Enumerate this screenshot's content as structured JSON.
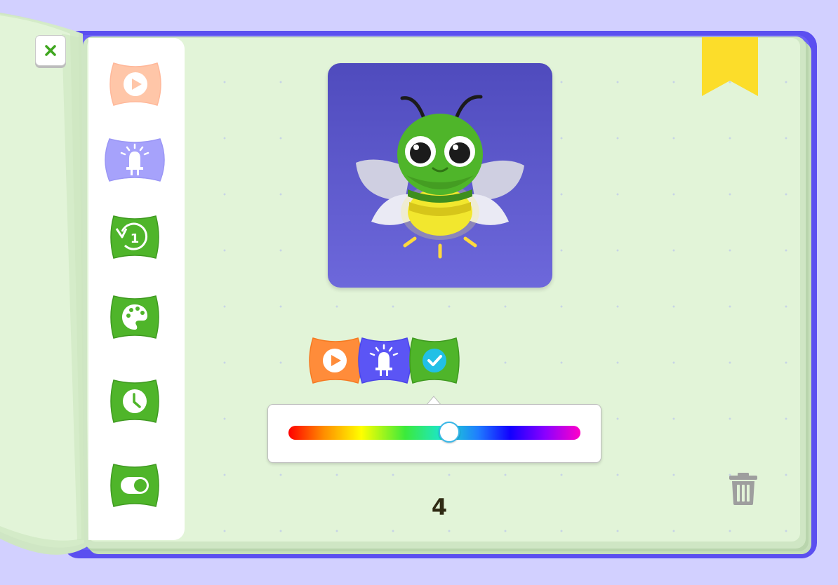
{
  "toolbar": {
    "close_icon": "close-icon",
    "bookmark_color": "#fcdd2a"
  },
  "palette": {
    "blocks": [
      {
        "icon": "play-icon",
        "category": "trigger",
        "color": "#ffc6a8",
        "state": "faded"
      },
      {
        "icon": "beacon-light-icon",
        "category": "light",
        "color": "#a6a2fb",
        "state": "faded"
      },
      {
        "icon": "repeat-once-icon",
        "label": "1",
        "category": "control",
        "color": "#4fb52a"
      },
      {
        "icon": "color-palette-icon",
        "category": "control",
        "color": "#4fb52a"
      },
      {
        "icon": "clock-icon",
        "category": "control",
        "color": "#4fb52a"
      },
      {
        "icon": "toggle-icon",
        "category": "control",
        "color": "#4fb52a"
      }
    ]
  },
  "stage": {
    "character": "firefly",
    "background": "#5b57c9"
  },
  "program": {
    "blocks": [
      {
        "icon": "play-icon",
        "color": "#ff8c3a"
      },
      {
        "icon": "beacon-light-icon",
        "color": "#5b55f5"
      },
      {
        "icon": "color-check-icon",
        "color": "#4fb52a",
        "selected_color": "#21c0e6"
      }
    ]
  },
  "color_picker": {
    "hue_value": 0.55,
    "selected_color": "#21c0e6"
  },
  "counter": {
    "value": "4"
  },
  "colors": {
    "background": "#d2d0ff",
    "book_cover": "#5b4ff0",
    "page": "#e2f4d8",
    "trash": "#9e9e9e"
  }
}
